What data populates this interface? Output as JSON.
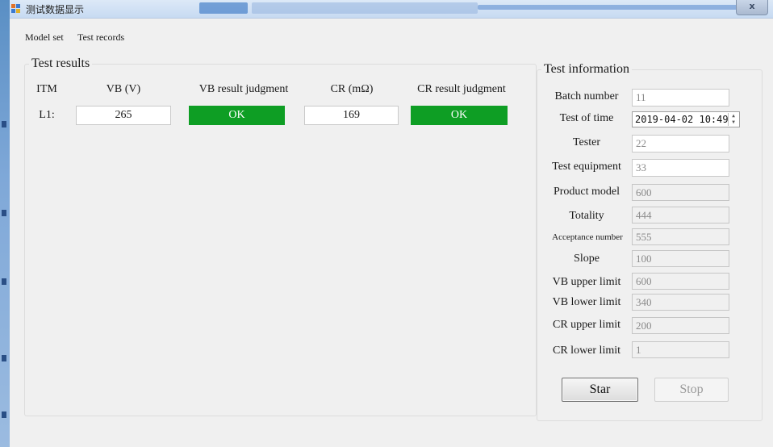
{
  "window": {
    "title": "测试数据显示",
    "close_glyph": "x"
  },
  "menu": {
    "items": [
      "Model set",
      "Test records"
    ]
  },
  "results": {
    "legend": "Test results",
    "headers": [
      "ITM",
      "VB (V)",
      "VB result judgment",
      "CR (mΩ)",
      "CR result judgment"
    ],
    "row": {
      "label": "L1:",
      "vb": "265",
      "vb_judgment": "OK",
      "cr": "169",
      "cr_judgment": "OK"
    },
    "ok_color": "#0e9e24"
  },
  "info": {
    "legend": "Test information",
    "batch_label": "Batch number",
    "batch_value": "11",
    "time_label": "Test of time",
    "time_value": "2019-04-02 10:49",
    "tester_label": "Tester",
    "tester_value": "22",
    "equipment_label": "Test equipment",
    "equipment_value": "33",
    "model_label": "Product model",
    "model_value": "600",
    "totality_label": "Totality",
    "totality_value": "444",
    "acceptance_label": "Acceptance number",
    "acceptance_value": "555",
    "slope_label": "Slope",
    "slope_value": "100",
    "vb_upper_label": "VB upper limit",
    "vb_upper_value": "600",
    "vb_lower_label": "VB lower limit",
    "vb_lower_value": "340",
    "cr_upper_label": "CR upper limit",
    "cr_upper_value": "200",
    "cr_lower_label": "CR lower limit",
    "cr_lower_value": "1"
  },
  "buttons": {
    "star": "Star",
    "stop": "Stop"
  }
}
